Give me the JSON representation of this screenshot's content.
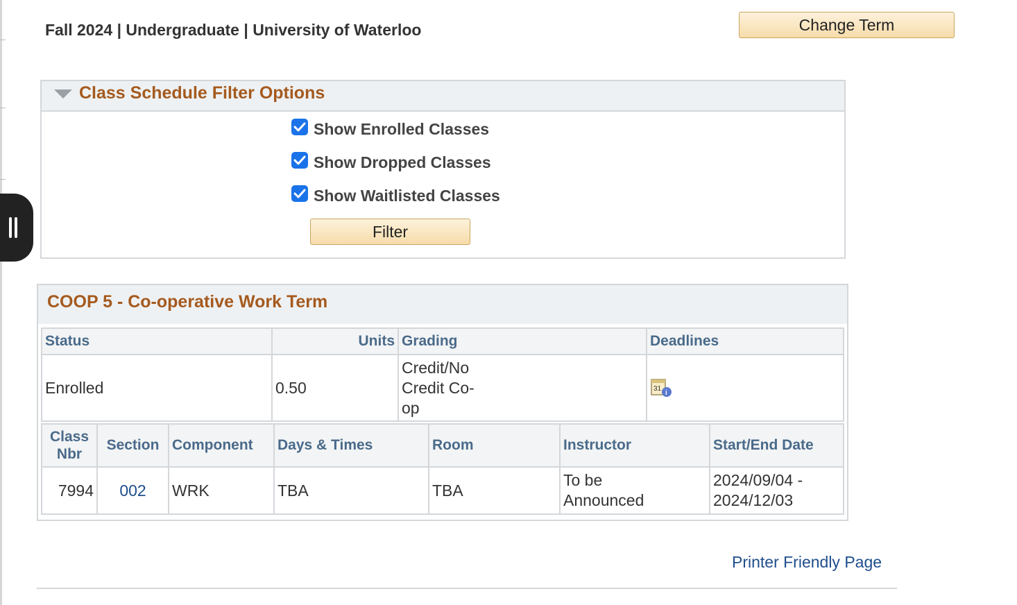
{
  "header": {
    "term_title": "Fall 2024 | Undergraduate | University of Waterloo",
    "change_term_label": "Change Term"
  },
  "filter": {
    "title": "Class Schedule Filter Options",
    "options": [
      {
        "label": "Show Enrolled Classes",
        "checked": true
      },
      {
        "label": "Show Dropped Classes",
        "checked": true
      },
      {
        "label": "Show Waitlisted Classes",
        "checked": true
      }
    ],
    "button_label": "Filter"
  },
  "course": {
    "title": "COOP 5 - Co-operative Work Term",
    "summary_headers": {
      "status": "Status",
      "units": "Units",
      "grading": "Grading",
      "deadlines": "Deadlines"
    },
    "summary": {
      "status": "Enrolled",
      "units": "0.50",
      "grading_lines": [
        "Credit/No",
        "Credit Co-",
        "op"
      ]
    },
    "class_headers": {
      "class_nbr_1": "Class",
      "class_nbr_2": "Nbr",
      "section": "Section",
      "component": "Component",
      "days_times": "Days & Times",
      "room": "Room",
      "instructor": "Instructor",
      "dates": "Start/End Date"
    },
    "class_row": {
      "class_nbr": "7994",
      "section": "002",
      "component": "WRK",
      "days_times": "TBA",
      "room": "TBA",
      "instructor_1": "To be",
      "instructor_2": "Announced",
      "date_1": "2024/09/04 -",
      "date_2": "2024/12/03"
    }
  },
  "footer": {
    "printer_link": "Printer Friendly Page"
  },
  "colors": {
    "section_title": "#a55a1e",
    "header_text": "#4a6a8a",
    "link": "#1f4e8c",
    "checkbox": "#1a73e8"
  }
}
